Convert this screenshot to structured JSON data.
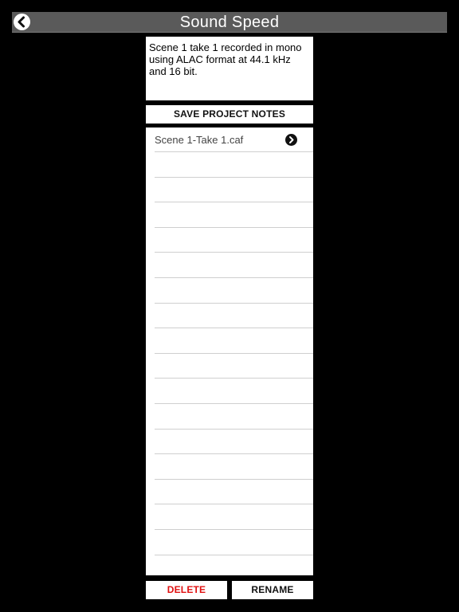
{
  "header": {
    "title": "Sound Speed",
    "back_icon": "chevron-left-circle-icon"
  },
  "notes": {
    "text": "Scene 1 take 1 recorded in mono using ALAC format at 44.1 kHz and 16 bit."
  },
  "actions": {
    "save_label": "SAVE PROJECT NOTES",
    "delete_label": "DELETE",
    "rename_label": "RENAME"
  },
  "files": {
    "items": [
      {
        "name": "Scene 1-Take 1.caf",
        "icon": "chevron-right-circle-icon"
      }
    ],
    "empty_row_count": 17
  },
  "colors": {
    "background": "#000000",
    "title_bar": "#5a5a5a",
    "delete": "#e01010"
  }
}
